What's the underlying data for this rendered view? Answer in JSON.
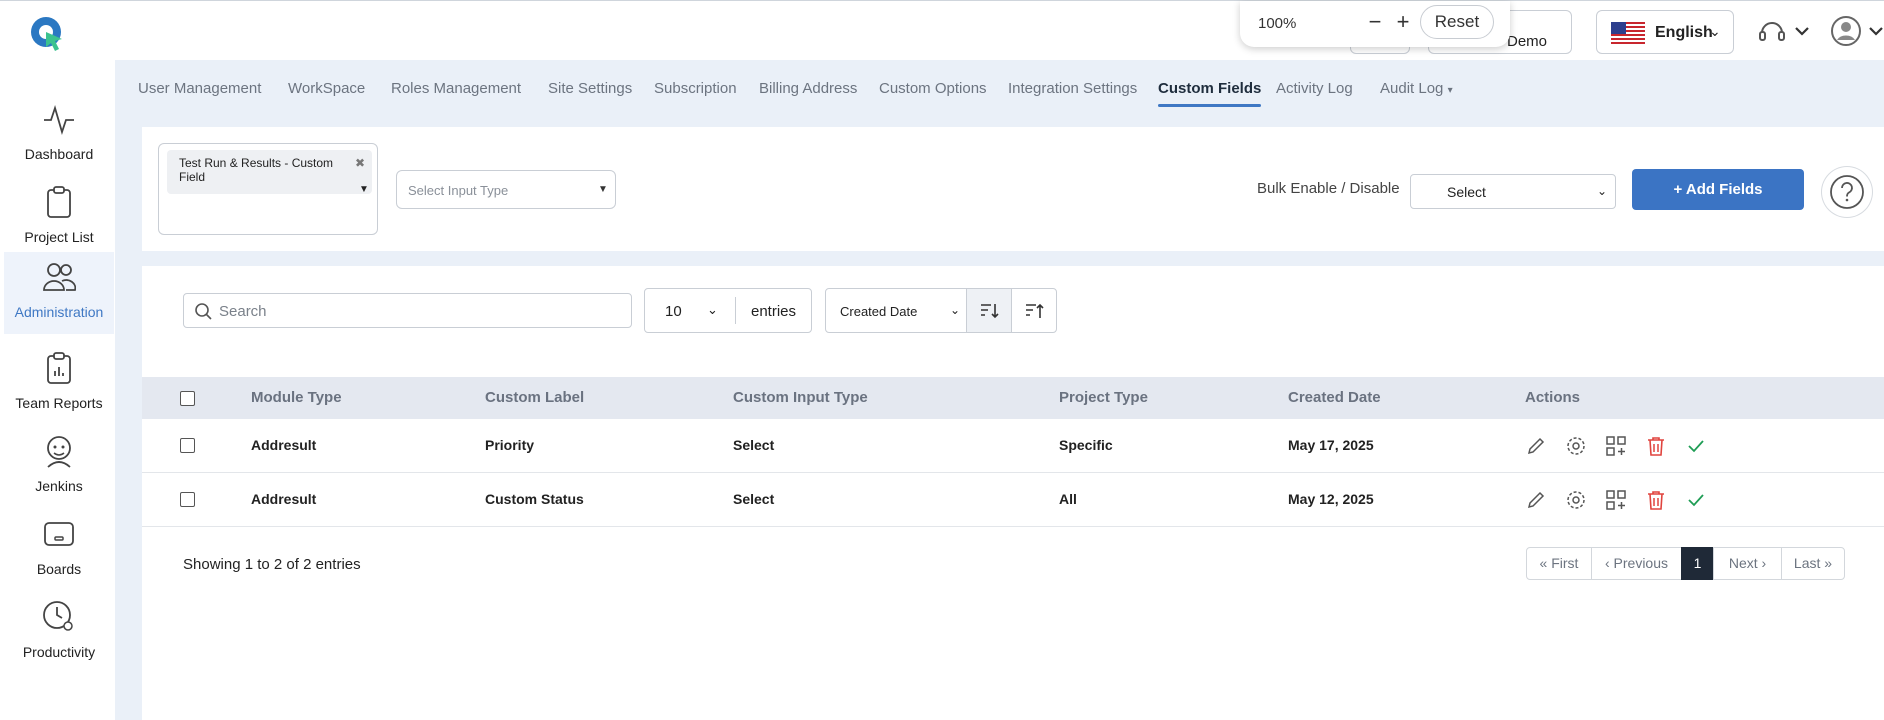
{
  "zoom": {
    "level": "100%",
    "minus": "−",
    "plus": "+",
    "reset": "Reset"
  },
  "header": {
    "demo_label": "Demo",
    "language": "English"
  },
  "sidebar": {
    "items": [
      {
        "label": "Dashboard",
        "icon": "activity-icon"
      },
      {
        "label": "Project List",
        "icon": "clipboard-icon"
      },
      {
        "label": "Administration",
        "icon": "users-icon",
        "active": true
      },
      {
        "label": "Team Reports",
        "icon": "clipboard-chart-icon"
      },
      {
        "label": "Jenkins",
        "icon": "jenkins-icon"
      },
      {
        "label": "Boards",
        "icon": "board-icon"
      },
      {
        "label": "Productivity",
        "icon": "clock-gear-icon"
      }
    ]
  },
  "tabs": [
    "User Management",
    "WorkSpace",
    "Roles Management",
    "Site Settings",
    "Subscription",
    "Billing Address",
    "Custom Options",
    "Integration Settings",
    "Custom Fields",
    "Activity Log",
    "Audit Log"
  ],
  "active_tab": "Custom Fields",
  "filters": {
    "module_chip": "Test Run & Results - Custom Field",
    "input_type_placeholder": "Select Input Type",
    "bulk_label": "Bulk Enable / Disable",
    "bulk_value": "Select",
    "add_button": "Add Fields"
  },
  "toolbar": {
    "search_placeholder": "Search",
    "entries_value": "10",
    "entries_label": "entries",
    "sort_value": "Created Date"
  },
  "table": {
    "columns": [
      "Module Type",
      "Custom Label",
      "Custom Input Type",
      "Project Type",
      "Created Date",
      "Actions"
    ],
    "rows": [
      [
        "Addresult",
        "Priority",
        "Select",
        "Specific",
        "May 17, 2025"
      ],
      [
        "Addresult",
        "Custom Status",
        "Select",
        "All",
        "May 12, 2025"
      ]
    ]
  },
  "footer": {
    "showing": "Showing 1 to 2 of 2 entries",
    "pager": {
      "first": "« First",
      "previous": "‹ Previous",
      "current": "1",
      "next": "Next ›",
      "last": "Last »"
    }
  },
  "colors": {
    "accent": "#3b74c4",
    "danger": "#e0443e",
    "success": "#1f9d55"
  }
}
